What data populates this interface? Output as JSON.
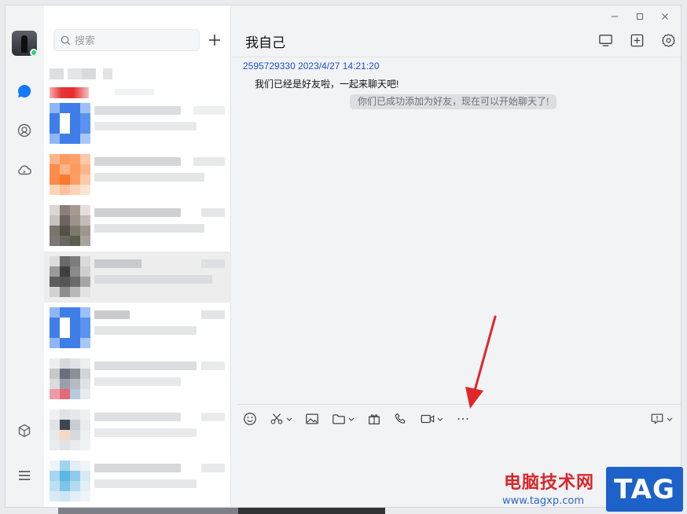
{
  "search": {
    "placeholder": "搜索"
  },
  "chat": {
    "title": "我自己",
    "message": {
      "meta": "2595729330 2023/4/27 14:21:20",
      "text": "我们已经是好友啦，一起来聊天吧!"
    },
    "system_tip": "你们已成功添加为好友，现在可以开始聊天了!"
  },
  "watermark": {
    "brand_text": "电脑技术网",
    "url": "www.tagxp.com",
    "badge": "TAG"
  },
  "icons": {
    "rail": [
      "message-icon",
      "contacts-icon",
      "cloud-icon",
      "apps-box-icon",
      "menu-icon"
    ],
    "header": [
      "screen-share-icon",
      "add-chat-icon",
      "settings-icon"
    ],
    "toolbar": [
      "emoji-icon",
      "scissors-icon",
      "image-icon",
      "folder-icon",
      "gift-icon",
      "phone-icon",
      "video-icon",
      "more-icon"
    ],
    "toolbar_right": "chat-history-icon"
  },
  "colors": {
    "accent": "#1677ff",
    "meta_text": "#1d4fd0",
    "online": "#2bd46a",
    "annotation_arrow": "#e0262b"
  }
}
